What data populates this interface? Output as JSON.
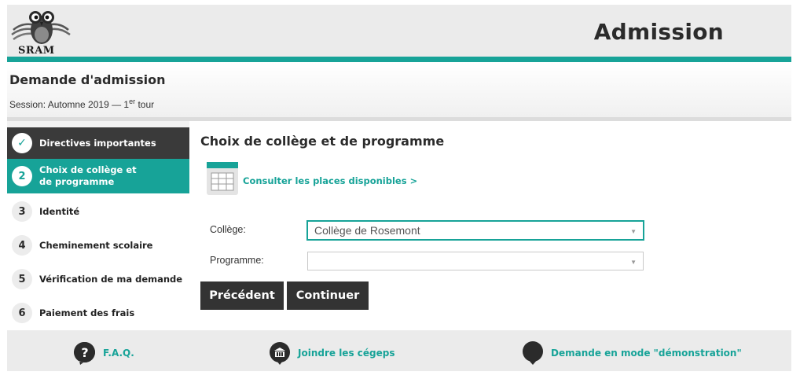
{
  "header": {
    "logo_text": "SRAM",
    "title": "Admission"
  },
  "subheader": {
    "title": "Demande d'admission",
    "session_prefix": "Session: Automne 2019 — 1",
    "session_sup": "er",
    "session_suffix": " tour"
  },
  "steps": [
    {
      "number": "✓",
      "label": "Directives importantes",
      "state": "done"
    },
    {
      "number": "2",
      "label": "Choix de collège et de programme",
      "state": "active"
    },
    {
      "number": "3",
      "label": "Identité",
      "state": "pending"
    },
    {
      "number": "4",
      "label": "Cheminement scolaire",
      "state": "pending"
    },
    {
      "number": "5",
      "label": "Vérification de ma demande",
      "state": "pending"
    },
    {
      "number": "6",
      "label": "Paiement des frais",
      "state": "pending"
    }
  ],
  "main": {
    "title": "Choix de collège et de programme",
    "places_link": "Consulter les places disponibles >",
    "college_label": "Collège:",
    "college_value": "Collège de Rosemont",
    "program_label": "Programme:",
    "program_value": "",
    "prev_button": "Précédent",
    "next_button": "Continuer"
  },
  "footer": {
    "faq": "F.A.Q.",
    "contact": "Joindre les cégeps",
    "demo": "Demande en mode \"démonstration\""
  },
  "colors": {
    "accent": "#17a398",
    "dark": "#333333"
  }
}
